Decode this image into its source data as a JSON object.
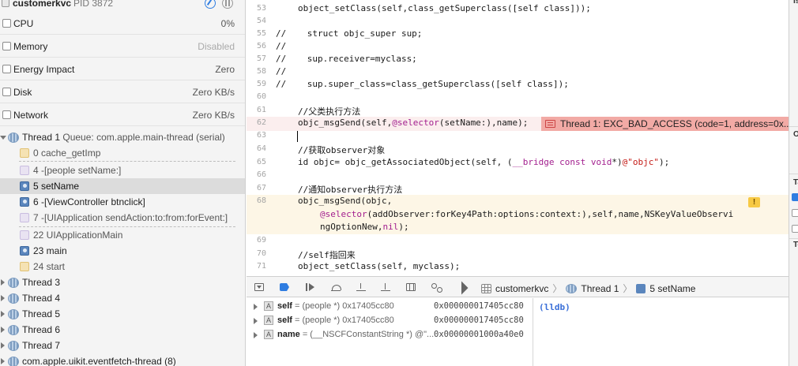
{
  "process": {
    "name": "customerkvc",
    "pid": "PID 3872"
  },
  "gauges": [
    {
      "label": "CPU",
      "value": "0%"
    },
    {
      "label": "Memory",
      "value": "Disabled"
    },
    {
      "label": "Energy Impact",
      "value": "Zero"
    },
    {
      "label": "Disk",
      "value": "Zero KB/s"
    },
    {
      "label": "Network",
      "value": "Zero KB/s"
    }
  ],
  "thread1": {
    "label": "Thread 1",
    "queue": "Queue: com.apple.main-thread (serial)"
  },
  "frames": [
    {
      "label": "0 cache_getImp"
    },
    {
      "label": "4 -[people setName:]"
    },
    {
      "label": "5 setName"
    },
    {
      "label": "6 -[ViewController btnclick]"
    },
    {
      "label": "7 -[UIApplication sendAction:to:from:forEvent:]"
    },
    {
      "label": "22 UIApplicationMain"
    },
    {
      "label": "23 main"
    },
    {
      "label": "24 start"
    }
  ],
  "threads": [
    {
      "label": "Thread 3"
    },
    {
      "label": "Thread 4"
    },
    {
      "label": "Thread 5"
    },
    {
      "label": "Thread 6"
    },
    {
      "label": "Thread 7"
    },
    {
      "label": "com.apple.uikit.eventfetch-thread (8)"
    }
  ],
  "code": {
    "lines": {
      "l53": {
        "num": "53",
        "text": "object_setClass(self,class_getSuperclass([self class]));"
      },
      "l54": {
        "num": "54"
      },
      "l55": {
        "num": "55",
        "text": "//    struct objc_super sup;"
      },
      "l56": {
        "num": "56",
        "text": "//"
      },
      "l57": {
        "num": "57",
        "text": "//    sup.receiver=myclass;"
      },
      "l58": {
        "num": "58",
        "text": "//"
      },
      "l59": {
        "num": "59",
        "text": "//    sup.super_class=class_getSuperclass([self class]);"
      },
      "l60": {
        "num": "60"
      },
      "l61": {
        "num": "61",
        "text": "//父类执行方法"
      },
      "l62": {
        "num": "62",
        "a": "objc_msgSend(self,",
        "b": "@selector",
        "c": "(setName:),name);"
      },
      "l63": {
        "num": "63"
      },
      "l64": {
        "num": "64",
        "text": "//获取observer对象"
      },
      "l65": {
        "num": "65",
        "a": "id objc= objc_getAssociatedObject(self, (",
        "b": "__bridge const void",
        "c": "*)",
        "d": "@\"objc\"",
        "e": ");"
      },
      "l66": {
        "num": "66"
      },
      "l67": {
        "num": "67",
        "text": "//通知observer执行方法"
      },
      "l68": {
        "num": "68",
        "a": "objc_msgSend(objc,"
      },
      "l68b": {
        "a": "@selector",
        "b": "(addObserver:forKey4Path:options:context:),self,name,NSKeyValueObservi"
      },
      "l68c": {
        "a": "ngOptionNew,",
        "b": "nil",
        "c": ");"
      },
      "l69": {
        "num": "69"
      },
      "l70": {
        "num": "70",
        "text": "//self指回来"
      },
      "l71": {
        "num": "71",
        "text": "object_setClass(self, myclass);"
      }
    },
    "error": "Thread 1: EXC_BAD_ACCESS (code=1, address=0x...",
    "warning": "!"
  },
  "breadcrumb": {
    "target": "customerkvc",
    "thread": "Thread 1",
    "frame": "5 setName"
  },
  "variables": [
    {
      "name": "self",
      "type": "= (people *) 0x17405cc80",
      "addr": "0x000000017405cc80"
    },
    {
      "name": "self",
      "type": "= (people *) 0x17405cc80",
      "addr": "0x000000017405cc80"
    },
    {
      "name": "name",
      "type": "= (__NSCFConstantString *) @\"...",
      "addr": "0x00000001000a40e0"
    }
  ],
  "console": {
    "prompt": "(lldb)"
  },
  "inspector": {
    "t1": "Is",
    "t2": "O",
    "t3": "Ta",
    "t4": "Te"
  },
  "colors": {
    "error": "#f2aaa5",
    "warning_line": "#fdf6e6",
    "accent": "#2f7de1"
  }
}
